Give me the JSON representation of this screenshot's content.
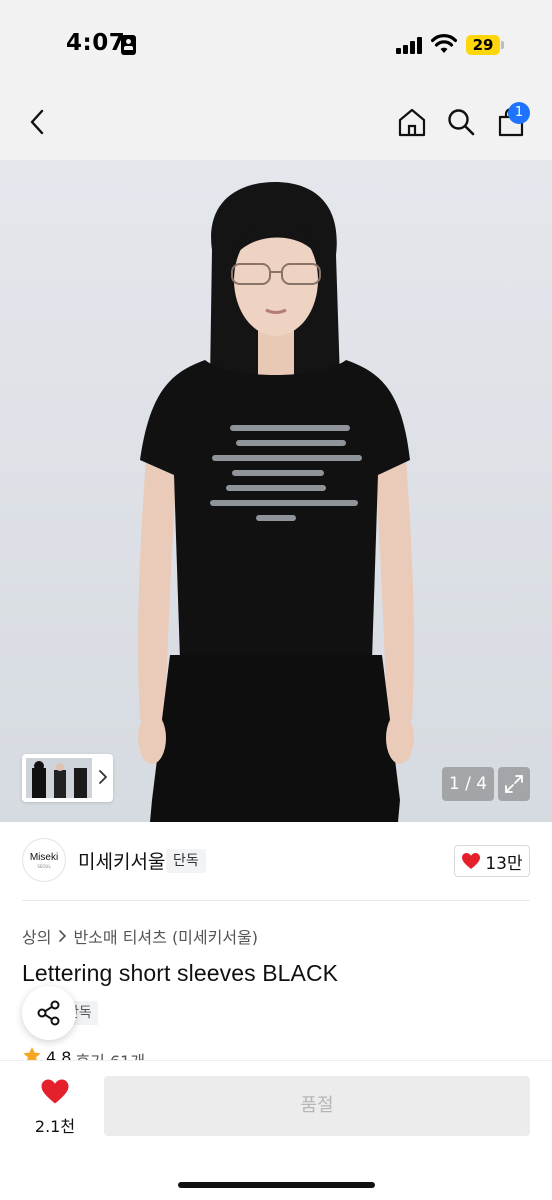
{
  "status_bar": {
    "time": "4:07",
    "battery": "29"
  },
  "nav": {
    "back_icon": "chevron-left-icon",
    "home_icon": "home-icon",
    "search_icon": "search-icon",
    "cart_icon": "shopping-bag-icon",
    "cart_badge": "1"
  },
  "gallery": {
    "counter": "1 / 4",
    "expand_icon": "expand-icon"
  },
  "brand": {
    "logo_text": "Miseki",
    "logo_sub": "SEOUL",
    "name": "미세키서울",
    "badge": "단독",
    "likes": "13만"
  },
  "breadcrumb": {
    "category": "상의",
    "subcategory": "반소매 티셔츠 (미세키서울)"
  },
  "product": {
    "title": "Lettering short sleeves BLACK",
    "tag": "단독",
    "rating": "4.8",
    "reviews": "후기 61개"
  },
  "bottom_bar": {
    "wish_count": "2.1천",
    "action_label": "품절"
  },
  "colors": {
    "accent_blue": "#1e73ff",
    "heart_red": "#e5202d",
    "star_orange": "#f5a623",
    "battery_yellow": "#ffd60a"
  }
}
